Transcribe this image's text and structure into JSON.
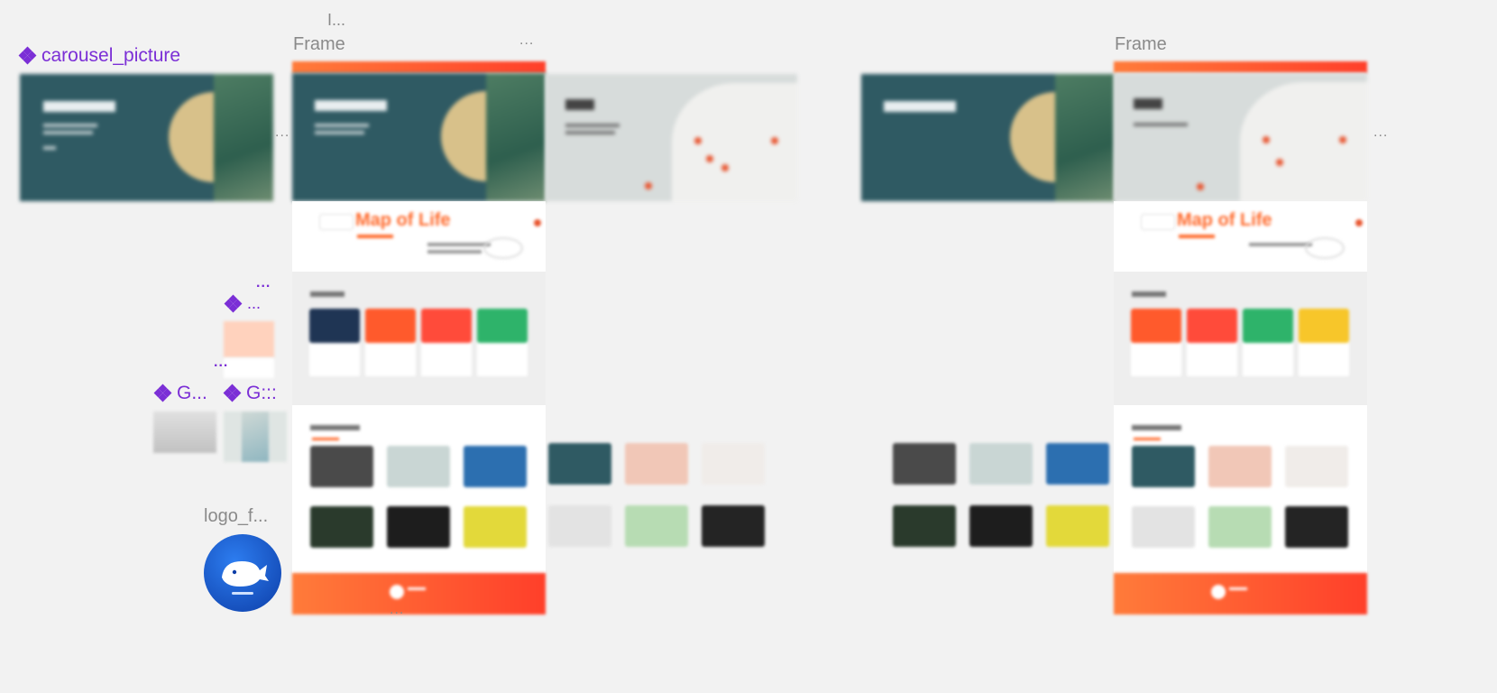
{
  "labels": {
    "carousel_component": "carousel_picture",
    "left_frame": "Frame",
    "right_frame": "Frame",
    "truncated_top": "I...",
    "logo_label": "logo_f...",
    "comp_small_1": "...",
    "comp_g1": "G...",
    "comp_g2": "G:::",
    "ellipsis": "..."
  },
  "mockup": {
    "headline": "Map of Life"
  },
  "colors": {
    "canvas": "#f2f2f2",
    "component_purple": "#7b2fd6",
    "brand_orange": "#ff5a2c",
    "hero_teal": "#2f5a63",
    "logo_blue": "#1457c8"
  }
}
